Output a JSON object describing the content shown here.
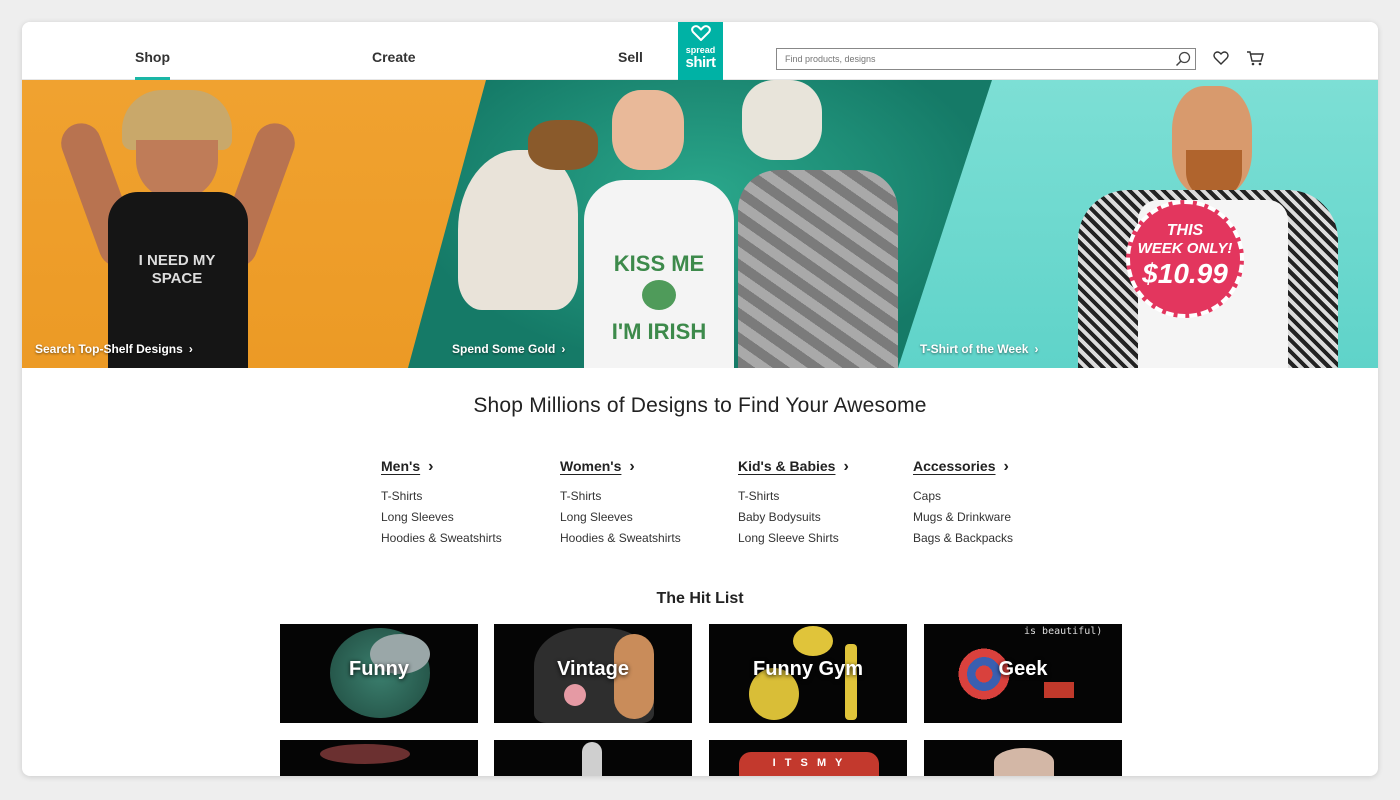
{
  "nav": {
    "shop": "Shop",
    "create": "Create",
    "sell": "Sell"
  },
  "logo": {
    "line1": "spread",
    "line2": "shirt"
  },
  "search": {
    "placeholder": "Find products, designs"
  },
  "icons": {
    "search": "search-icon",
    "wishlist": "heart-icon",
    "cart": "cart-icon"
  },
  "hero": {
    "panel1": {
      "link": "Search Top-Shelf Designs",
      "shirt_text": "I NEED MY SPACE",
      "bg": "#F0A230"
    },
    "panel2": {
      "link": "Spend Some Gold",
      "shirt_text_top": "KISS ME",
      "shirt_text_bottom": "I'M IRISH",
      "bg": "#1E8F76"
    },
    "panel3": {
      "link": "T-Shirt of the Week",
      "bg": "#6FD9CF"
    },
    "badge": {
      "line1": "THIS",
      "line2": "WEEK ONLY!",
      "price": "$10.99",
      "color": "#E3365E"
    }
  },
  "headline": "Shop Millions of Designs to Find Your Awesome",
  "categories": [
    {
      "title": "Men's",
      "links": [
        "T-Shirts",
        "Long Sleeves",
        "Hoodies & Sweatshirts"
      ]
    },
    {
      "title": "Women's",
      "links": [
        "T-Shirts",
        "Long Sleeves",
        "Hoodies & Sweatshirts"
      ]
    },
    {
      "title": "Kid's & Babies",
      "links": [
        "T-Shirts",
        "Baby Bodysuits",
        "Long Sleeve Shirts"
      ]
    },
    {
      "title": "Accessories",
      "links": [
        "Caps",
        "Mugs & Drinkware",
        "Bags & Backpacks"
      ]
    }
  ],
  "hit_list": {
    "title": "The Hit List",
    "tiles": [
      "Funny",
      "Vintage",
      "Funny Gym",
      "Geek"
    ],
    "geek_art_text": "is beautiful)",
    "row2_art_text": "I T S M Y"
  },
  "colors": {
    "accent": "#00B2A5"
  }
}
